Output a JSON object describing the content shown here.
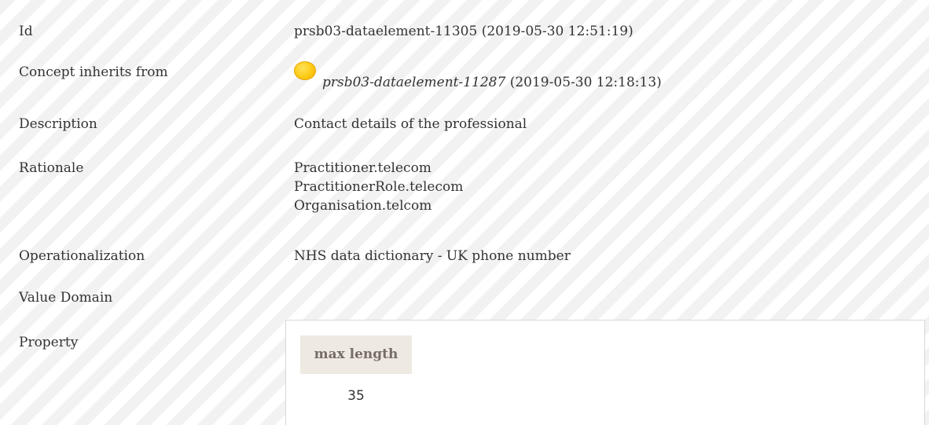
{
  "rows": {
    "id": {
      "label": "Id",
      "value": "prsb03-dataelement-11305 (2019-05-30 12:51:19)"
    },
    "inherits": {
      "label": "Concept inherits from",
      "link": "prsb03-dataelement-11287",
      "date": " (2019-05-30 12:18:13)",
      "icon": "inherit-circle-icon",
      "icon_color": "#fcca13"
    },
    "description": {
      "label": "Description",
      "value": "Contact details of the professional"
    },
    "rationale": {
      "label": "Rationale",
      "lines": [
        "Practitioner.telecom",
        "PractitionerRole.telecom",
        "Organisation.telcom"
      ]
    },
    "operationalization": {
      "label": "Operationalization",
      "value": "NHS data dictionary - UK phone number"
    },
    "value_domain": {
      "label": "Value Domain"
    },
    "property": {
      "label": "Property",
      "table": {
        "header": "max length",
        "value": "35"
      }
    }
  }
}
